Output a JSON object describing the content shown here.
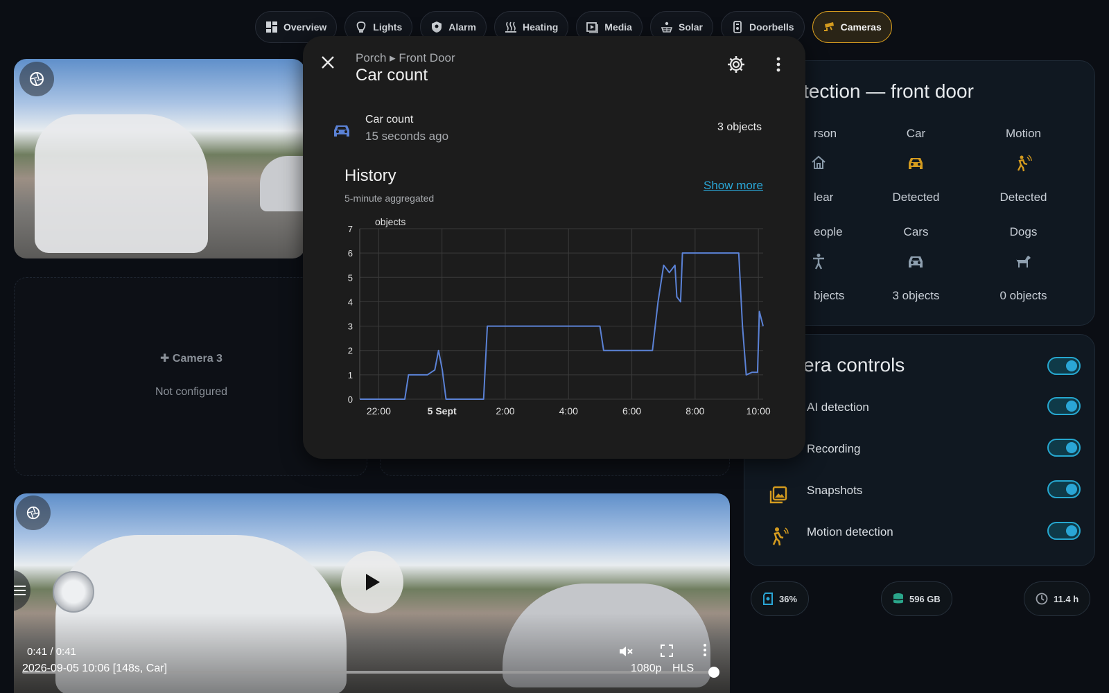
{
  "tabs": [
    {
      "label": "Overview",
      "icon": "dashboard-icon"
    },
    {
      "label": "Lights",
      "icon": "bulb-icon"
    },
    {
      "label": "Alarm",
      "icon": "shield-icon"
    },
    {
      "label": "Heating",
      "icon": "heat-icon"
    },
    {
      "label": "Media",
      "icon": "media-icon"
    },
    {
      "label": "Solar",
      "icon": "solar-icon"
    },
    {
      "label": "Doorbells",
      "icon": "doorbell-icon"
    },
    {
      "label": "Cameras",
      "icon": "cctv-icon",
      "active": true
    }
  ],
  "camera3": {
    "title": "Camera 3",
    "status": "Not configured"
  },
  "video": {
    "time": "0:41 / 0:41",
    "caption": "2026-09-05 10:06 [148s, Car]",
    "quality": "1080p",
    "format": "HLS",
    "progress": 1.0
  },
  "detection": {
    "title": "tection — front door",
    "row1": [
      {
        "label": "rson",
        "icon": "home-icon",
        "state": "lear"
      },
      {
        "label": "Car",
        "icon": "car-icon",
        "state": "Detected"
      },
      {
        "label": "Motion",
        "icon": "motion-icon",
        "state": "Detected"
      }
    ],
    "row2": [
      {
        "label": "eople",
        "icon": "person-icon",
        "state": "bjects"
      },
      {
        "label": "Cars",
        "icon": "car-icon",
        "state": "3 objects"
      },
      {
        "label": "Dogs",
        "icon": "dog-icon",
        "state": "0 objects"
      }
    ]
  },
  "controls": {
    "title": "era controls",
    "items": [
      {
        "label": "AI detection",
        "on": true
      },
      {
        "label": "Recording",
        "on": true
      },
      {
        "label": "Snapshots",
        "on": true
      },
      {
        "label": "Motion detection",
        "on": true
      }
    ]
  },
  "chips": [
    {
      "label": "36%",
      "icon": "sd-card-icon"
    },
    {
      "label": "596 GB",
      "icon": "database-icon"
    },
    {
      "label": "11.4 h",
      "icon": "clock-icon"
    }
  ],
  "dialog": {
    "breadcrumb": "Porch ▸ Front Door",
    "title": "Car count",
    "entity": {
      "name": "Car count",
      "time": "15 seconds ago",
      "value": "3 objects"
    },
    "history": {
      "title": "History",
      "subtitle": "5-minute aggregated",
      "show_more": "Show more"
    }
  },
  "chart_data": {
    "type": "line",
    "ylabel": "objects",
    "ylim": [
      0,
      7
    ],
    "yticks": [
      "0",
      "1",
      "2",
      "3",
      "4",
      "5",
      "6",
      "7"
    ],
    "xticks": [
      "22:00",
      "5 Sept",
      "2:00",
      "4:00",
      "6:00",
      "8:00",
      "10:00"
    ],
    "xlim": [
      21.4,
      32.15
    ],
    "grid": true,
    "color": "#5b82d6",
    "series": [
      {
        "x": [
          21.4,
          22.6,
          22.7,
          23.2,
          23.4,
          23.5,
          23.6,
          23.7,
          24.7,
          24.8,
          27.8,
          27.9,
          29.2,
          29.35,
          29.5,
          29.65,
          29.8,
          29.85,
          29.95,
          30.0,
          30.1,
          30.15,
          31.5,
          31.6,
          31.7,
          31.85,
          32.0,
          32.05,
          32.15
        ],
        "y": [
          0,
          0,
          1,
          1,
          1.2,
          2,
          1.2,
          0,
          0,
          3,
          3,
          2,
          2,
          4,
          5.5,
          5.2,
          5.5,
          4.2,
          4,
          6,
          6,
          6,
          6,
          3,
          1,
          1.1,
          1.1,
          3.6,
          3
        ]
      }
    ]
  }
}
